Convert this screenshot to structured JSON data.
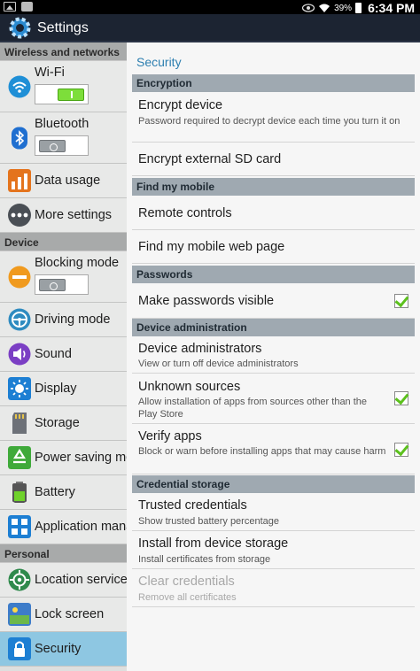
{
  "status_bar": {
    "battery_pct": "39%",
    "time": "6:34 PM"
  },
  "app": {
    "title": "Settings"
  },
  "sidebar": {
    "wireless_header": "Wireless and networks",
    "wifi": {
      "label": "Wi-Fi",
      "toggle": "on"
    },
    "bluetooth": {
      "label": "Bluetooth",
      "toggle": "off"
    },
    "data_usage": {
      "label": "Data usage"
    },
    "more_settings": {
      "label": "More settings"
    },
    "device_header": "Device",
    "blocking_mode": {
      "label": "Blocking mode",
      "toggle": "off"
    },
    "driving_mode": {
      "label": "Driving mode"
    },
    "sound": {
      "label": "Sound"
    },
    "display": {
      "label": "Display"
    },
    "storage": {
      "label": "Storage"
    },
    "power_saving": {
      "label": "Power saving mode"
    },
    "battery": {
      "label": "Battery"
    },
    "application_manager": {
      "label": "Application manager"
    },
    "personal_header": "Personal",
    "location_services": {
      "label": "Location services"
    },
    "lock_screen": {
      "label": "Lock screen"
    },
    "security": {
      "label": "Security",
      "selected": true
    }
  },
  "main": {
    "title": "Security",
    "encryption": {
      "header": "Encryption",
      "encrypt_device": {
        "title": "Encrypt device",
        "summary": "Password required to decrypt device each time you turn it on"
      },
      "encrypt_sd": {
        "title": "Encrypt external SD card"
      }
    },
    "find_my_mobile": {
      "header": "Find my mobile",
      "remote_controls": {
        "title": "Remote controls"
      },
      "web_page": {
        "title": "Find my mobile web page"
      }
    },
    "passwords": {
      "header": "Passwords",
      "make_visible": {
        "title": "Make passwords visible",
        "checked": true
      }
    },
    "device_admin": {
      "header": "Device administration",
      "administrators": {
        "title": "Device administrators",
        "summary": "View or turn off device administrators"
      },
      "unknown_sources": {
        "title": "Unknown sources",
        "summary": "Allow installation of apps from sources other than the Play Store",
        "checked": true
      },
      "verify_apps": {
        "title": "Verify apps",
        "summary": "Block or warn before installing apps that may cause harm",
        "checked": true
      }
    },
    "credential_storage": {
      "header": "Credential storage",
      "trusted": {
        "title": "Trusted credentials",
        "summary": "Show trusted battery percentage"
      },
      "install": {
        "title": "Install from device storage",
        "summary": "Install certificates from storage"
      },
      "clear": {
        "title": "Clear credentials",
        "summary": "Remove all certificates",
        "enabled": false
      }
    }
  }
}
